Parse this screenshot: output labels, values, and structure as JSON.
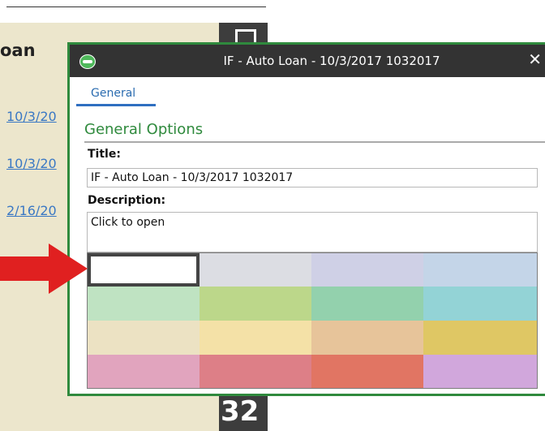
{
  "background": {
    "title": "oan",
    "links": [
      "10/3/20",
      "10/3/20",
      "2/16/20"
    ],
    "number": "32"
  },
  "dialog": {
    "title": "IF - Auto Loan - 10/3/2017 1032017",
    "close_label": "✕",
    "tab_label": "General",
    "section_heading": "General Options",
    "title_label": "Title:",
    "title_value": "IF - Auto Loan - 10/3/2017 1032017",
    "description_label": "Description:",
    "description_value": "Click to open"
  },
  "palette": {
    "rows": [
      [
        "#ffffff",
        "#dcdde3",
        "#cfd0e6",
        "#c4d5e8"
      ],
      [
        "#bfe3c2",
        "#bcd78a",
        "#93d1ad",
        "#93d3d6"
      ],
      [
        "#ece2c3",
        "#f4e1a7",
        "#e7c49a",
        "#dfc764"
      ],
      [
        "#e1a4be",
        "#dd7f87",
        "#e17563",
        "#d1a7dc"
      ]
    ],
    "selected_index": 0
  },
  "colors": {
    "accent_green": "#2f8a3d",
    "tab_blue": "#2f6fc1",
    "arrow_red": "#e02020"
  }
}
